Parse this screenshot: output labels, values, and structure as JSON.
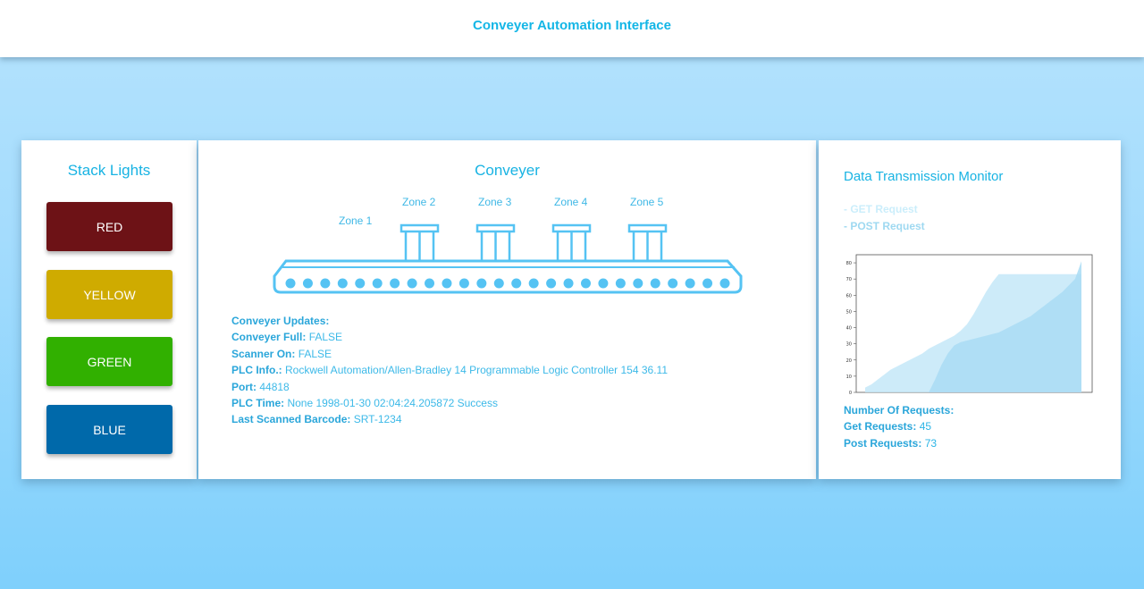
{
  "header": {
    "title": "Conveyer Automation Interface"
  },
  "stack_lights": {
    "title": "Stack Lights",
    "buttons": [
      {
        "label": "RED",
        "color": "#6d1216"
      },
      {
        "label": "YELLOW",
        "color": "#cfab00"
      },
      {
        "label": "GREEN",
        "color": "#31b000"
      },
      {
        "label": "BLUE",
        "color": "#0069aa"
      }
    ]
  },
  "conveyer": {
    "title": "Conveyer",
    "zones": [
      "Zone 1",
      "Zone 2",
      "Zone 3",
      "Zone 4",
      "Zone 5"
    ],
    "updates": {
      "heading": "Conveyer Updates:",
      "rows": [
        {
          "label": "Conveyer Full:",
          "value": "FALSE"
        },
        {
          "label": "Scanner On:",
          "value": "FALSE"
        },
        {
          "label": "PLC Info.:",
          "value": "Rockwell Automation/Allen-Bradley 14 Programmable Logic Controller 154 36.11"
        },
        {
          "label": "Port:",
          "value": "44818"
        },
        {
          "label": "PLC Time:",
          "value": "None 1998-01-30 02:04:24.205872 Success"
        },
        {
          "label": "Last Scanned Barcode:",
          "value": "SRT-1234"
        }
      ]
    }
  },
  "data_monitor": {
    "title": "Data Transmission Monitor",
    "legend": {
      "get": "- GET Request",
      "post": "- POST Request"
    },
    "requests": {
      "heading": "Number Of Requests:",
      "get_label": "Get Requests:",
      "get_value": "45",
      "post_label": "Post Requests:",
      "post_value": "73"
    }
  },
  "chart_data": {
    "type": "area",
    "title": "",
    "xlabel": "",
    "ylabel": "",
    "ylim": [
      0,
      85
    ],
    "yticks": [
      0,
      10,
      20,
      30,
      40,
      50,
      60,
      70,
      80
    ],
    "colors": {
      "get": "#c4e8f8",
      "post": "#a9dcf4"
    },
    "series": [
      {
        "key": "get",
        "values": [
          3,
          5,
          8,
          11,
          14,
          16,
          18,
          20,
          22,
          24,
          27,
          29,
          31,
          33,
          35,
          38,
          42,
          48,
          55,
          62,
          68,
          73,
          73,
          73,
          73,
          73,
          73,
          73,
          73,
          73,
          73,
          73,
          73,
          73,
          73
        ]
      },
      {
        "key": "post",
        "values": [
          0,
          0,
          0,
          0,
          0,
          0,
          0,
          0,
          0,
          0,
          0,
          8,
          17,
          24,
          29,
          31,
          32,
          33,
          34,
          35,
          36,
          37,
          39,
          41,
          43,
          45,
          47,
          50,
          53,
          56,
          59,
          62,
          66,
          70,
          81
        ]
      }
    ]
  }
}
